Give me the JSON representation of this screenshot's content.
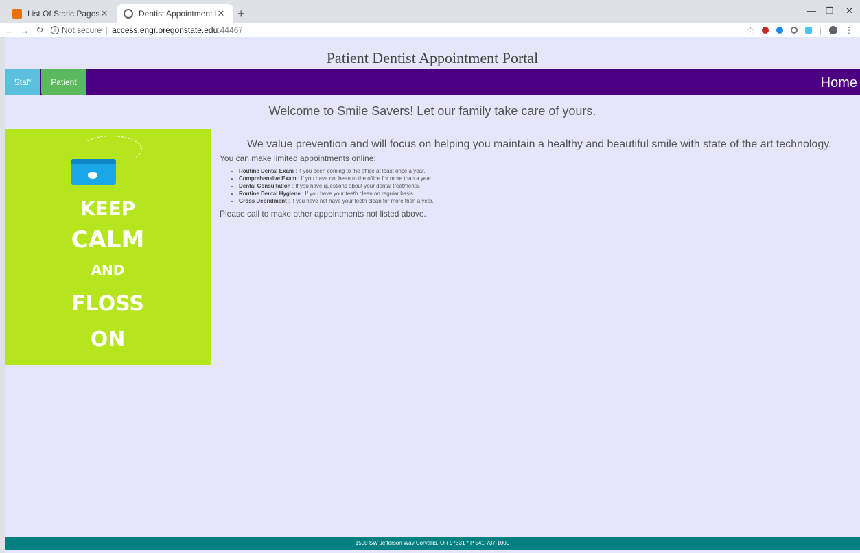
{
  "browser": {
    "tabs": [
      {
        "title": "List Of Static Pages",
        "active": false
      },
      {
        "title": "Dentist Appointment Portal",
        "active": true
      }
    ],
    "security_label": "Not secure",
    "url_host": "access.engr.oregonstate.edu",
    "url_port": ":44467"
  },
  "page": {
    "title": "Patient Dentist Appointment Portal",
    "nav": {
      "staff_label": "Staff",
      "patient_label": "Patient",
      "home_label": "Home"
    },
    "welcome": "Welcome to Smile Savers! Let our family take care of yours.",
    "poster": {
      "line1": "KEEP",
      "line2": "CALM",
      "line3": "AND",
      "line4": "FLOSS",
      "line5": "ON"
    },
    "value_statement": "We value prevention and will focus on helping you maintain a healthy and beautiful smile with state of the art technology.",
    "intro": "You can make limited appointments online:",
    "appointments": [
      {
        "name": "Routine Dental Exam",
        "desc": " : If you been coming to the office at least once a year."
      },
      {
        "name": "Comprehensive Exam",
        "desc": " : If you have not been to the office for more than a year."
      },
      {
        "name": "Dental Consultation",
        "desc": " : If you have questions about your dental treatments."
      },
      {
        "name": "Routine Dental Hygiene",
        "desc": " : If you have your teeth clean on regular basis."
      },
      {
        "name": "Gross Debridment",
        "desc": " : If you have not have your teeth clean for more than a year."
      }
    ],
    "other_note": "Please call to make other appointments not listed above.",
    "footer": "1500 SW Jefferson Way Corvallis, OR 97331 * P 541-737-1000"
  },
  "colors": {
    "navbar": "#4b0082",
    "staff": "#5bc0de",
    "patient": "#5cb85c",
    "footer": "#008080",
    "background": "#e6e6fa",
    "poster": "#b5e61d"
  }
}
